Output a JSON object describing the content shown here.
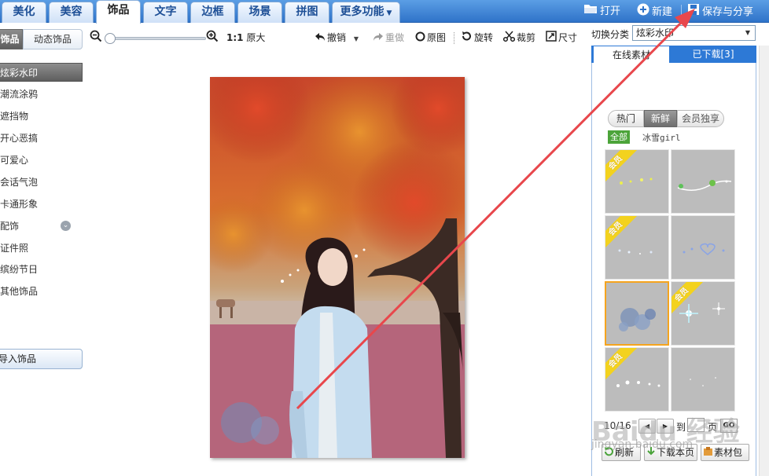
{
  "top_tabs": [
    {
      "label": "美化"
    },
    {
      "label": "美容"
    },
    {
      "label": "饰品"
    },
    {
      "label": "文字"
    },
    {
      "label": "边框"
    },
    {
      "label": "场景"
    },
    {
      "label": "拼图"
    },
    {
      "label": "更多功能"
    }
  ],
  "top_actions": {
    "open": "打开",
    "new": "新建",
    "save_share": "保存与分享"
  },
  "left_panel": {
    "tab_selected": "饰品",
    "tab_dynamic": "动态饰品",
    "items": [
      {
        "label": "炫彩水印"
      },
      {
        "label": "潮流涂鸦"
      },
      {
        "label": "遮挡物"
      },
      {
        "label": "开心恶搞"
      },
      {
        "label": "可爱心"
      },
      {
        "label": "会话气泡"
      },
      {
        "label": "卡通形象"
      },
      {
        "label": "配饰"
      },
      {
        "label": "证件照"
      },
      {
        "label": "缤纷节日"
      },
      {
        "label": "其他饰品"
      }
    ],
    "import_button": "导入饰品"
  },
  "toolbar": {
    "zoom_ratio": "1:1",
    "original_size": "原大",
    "undo": "撤销",
    "redo": "重做",
    "original_image": "原图",
    "rotate": "旋转",
    "crop": "裁剪",
    "resize": "尺寸"
  },
  "right_panel": {
    "category_label": "切换分类",
    "category_value": "炫彩水印",
    "tab_online": "在线素材",
    "tab_downloaded": "已下载[3]",
    "filter_hot": "热门",
    "filter_new": "新鲜",
    "filter_vip": "会员独享",
    "filter_all": "全部",
    "filter_user": "冰雪girl",
    "vip_badge": "会员",
    "thumbnails": [
      {
        "vip": true,
        "selected": false
      },
      {
        "vip": false,
        "selected": false
      },
      {
        "vip": true,
        "selected": false
      },
      {
        "vip": false,
        "selected": false
      },
      {
        "vip": false,
        "selected": true
      },
      {
        "vip": true,
        "selected": false
      },
      {
        "vip": true,
        "selected": false
      },
      {
        "vip": false,
        "selected": false
      }
    ],
    "page_info": "10/16",
    "page_to": "到",
    "page_unit": "页",
    "go_button": "GO",
    "refresh_button": "刷新",
    "download_page_button": "下载本页",
    "material_pack_button": "素材包"
  },
  "watermark": {
    "logo": "Baidu 经验",
    "url": "jingyan.baidu.com"
  },
  "colors": {
    "topbar_blue": "#2f73c9",
    "tab_blue_text": "#1d4f96",
    "selected_gray": "#6e6e6e",
    "vip_yellow": "#f3d21e",
    "selected_border_orange": "#f5a41e",
    "annotation_arrow_red": "#e8474c"
  }
}
